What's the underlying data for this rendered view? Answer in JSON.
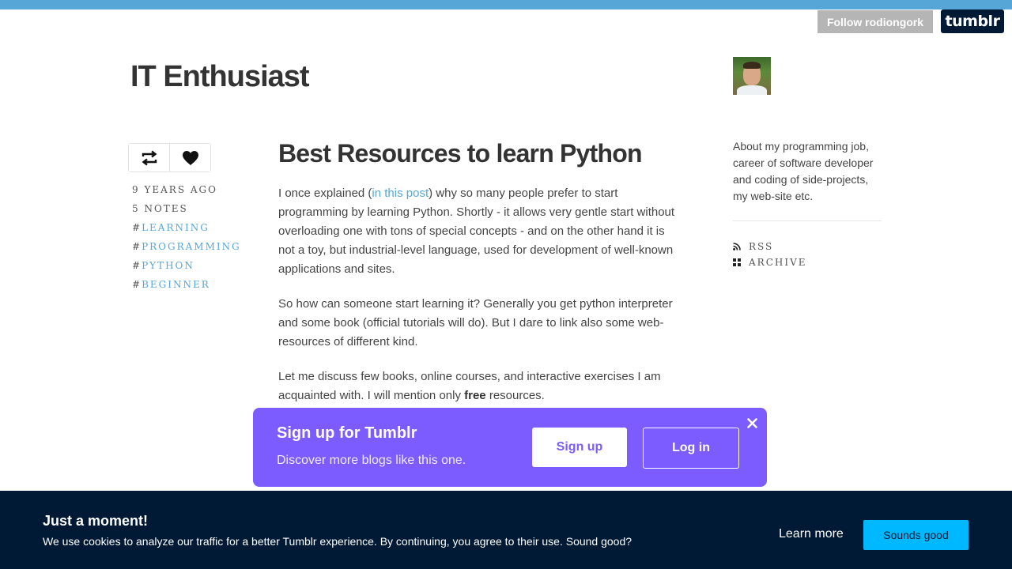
{
  "header": {
    "follow_label": "Follow rodiongork",
    "logo_text": "tumblr"
  },
  "blog": {
    "title": "IT Enthusiast"
  },
  "post": {
    "title": "Best Resources to learn Python",
    "meta": {
      "age": "9 YEARS AGO",
      "notes": "5 NOTES"
    },
    "tags": [
      "LEARNING",
      "PROGRAMMING",
      "PYTHON",
      "BEGINNER"
    ],
    "p1_before": "I once explained (",
    "p1_link": "in this post",
    "p1_after": ") why so many people prefer to start programming by learning Python. Shortly - it allows very gentle start without overloading one with tons of special concepts - and on the other hand it is not a toy, but industrial-level language, used for development of well-known applications and sites.",
    "p2": "So how can someone start learning it? Generally you get python interpreter and some book (official tutorials will do). But I dare to link also some web-resources of different kind.",
    "p3_before": "Let me discuss few books, online courses, and interactive exercises I am acquainted with. I will mention only ",
    "p3_bold": "free",
    "p3_after": " resources."
  },
  "sidebar": {
    "about": "About my programming job, career of software developer and coding of side-projects, my web-site etc.",
    "links": [
      {
        "label": "RSS",
        "icon": "rss-icon"
      },
      {
        "label": "ARCHIVE",
        "icon": "grid-icon"
      }
    ]
  },
  "signup_banner": {
    "title": "Sign up for Tumblr",
    "subtitle": "Discover more blogs like this one.",
    "signup_label": "Sign up",
    "login_label": "Log in"
  },
  "cookie_banner": {
    "title": "Just a moment!",
    "text": "We use cookies to analyze our traffic for a better Tumblr experience. By continuing, you agree to their use. Sound good?",
    "learn_more": "Learn more",
    "accept": "Sounds good"
  },
  "colors": {
    "topbar": "#56a7d8",
    "link": "#56a7d8",
    "signup_bg": "#7c5cff",
    "cookie_bg": "#001935",
    "accept_bg": "#00b8ff"
  }
}
